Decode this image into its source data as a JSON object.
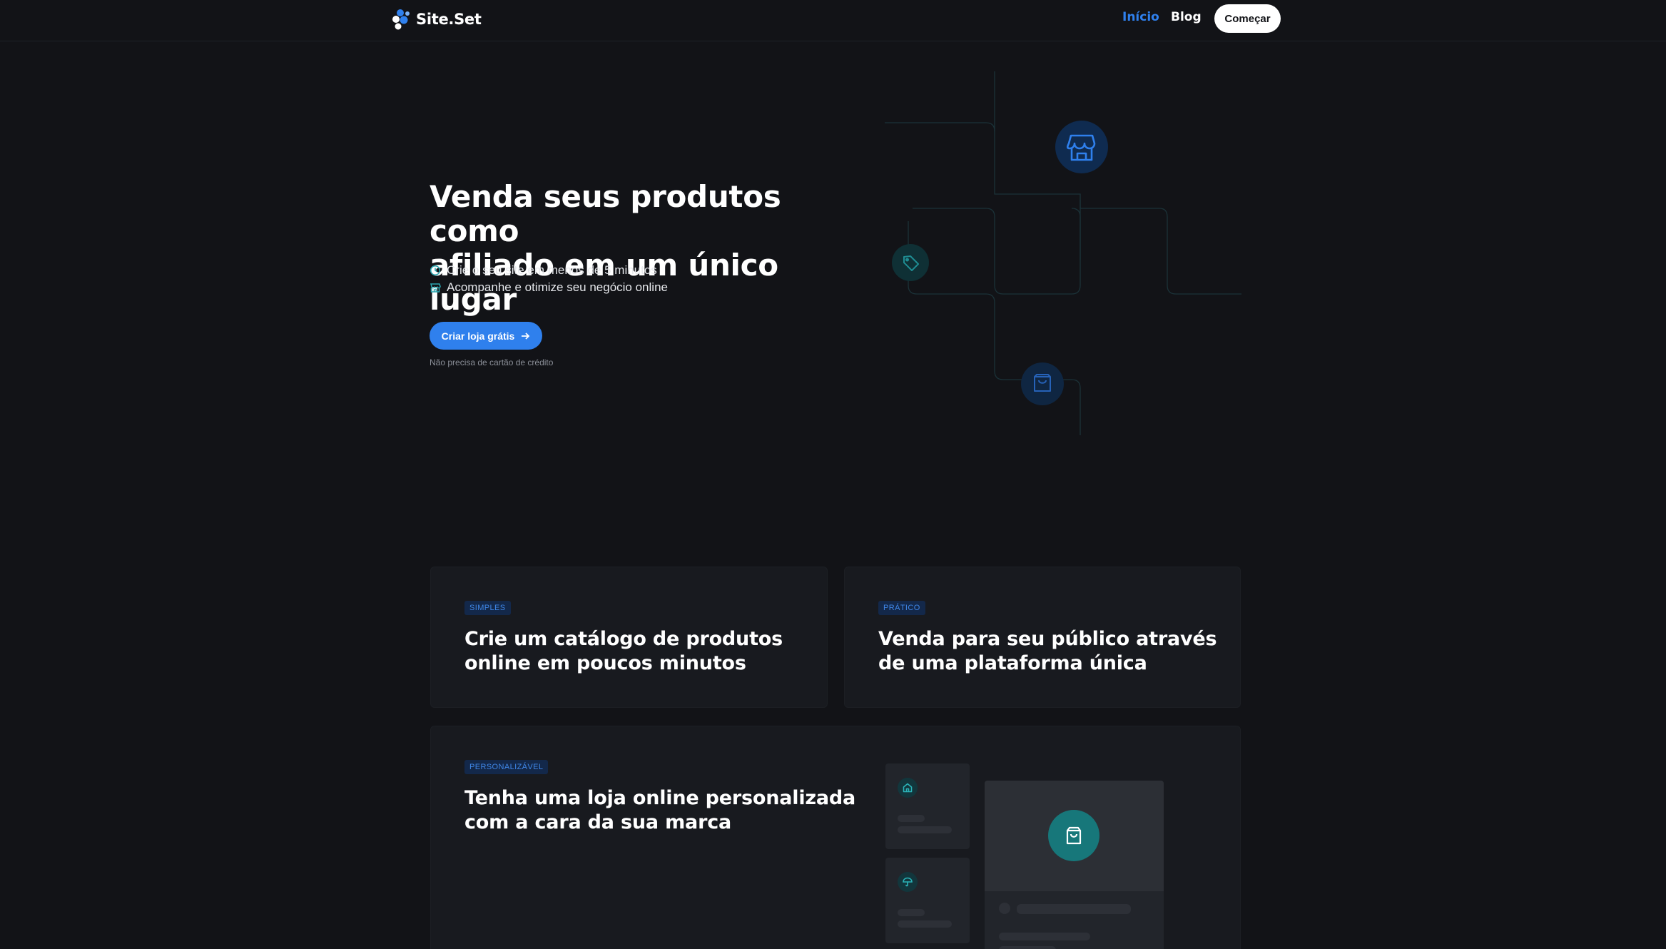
{
  "header": {
    "brand": "Site.Set",
    "nav": [
      {
        "label": "Início",
        "active": true
      },
      {
        "label": "Blog",
        "active": false
      }
    ],
    "cta_label": "Começar"
  },
  "hero": {
    "title_line1": "Venda seus produtos como",
    "title_line2": "afiliado em um único lugar",
    "features": [
      {
        "icon": "clock-icon",
        "text": "Crie o seu site em menos de 5 minutos"
      },
      {
        "icon": "store-icon",
        "text": "Acompanhe e otimize seu negócio online"
      }
    ],
    "cta_label": "Criar loja grátis",
    "cta_note": "Não precisa de cartão de crédito",
    "illustration_icons": [
      "store-icon",
      "tag-icon",
      "shopping-bag-icon"
    ]
  },
  "cards": [
    {
      "tag": "SIMPLES",
      "title_line1": "Crie um catálogo de produtos",
      "title_line2": "online em poucos minutos"
    },
    {
      "tag": "PRÁTICO",
      "title_line1": "Venda para seu público através",
      "title_line2": "de uma plataforma única"
    },
    {
      "tag": "PERSONALIZÁVEL",
      "title_line1": "Tenha uma loja online personalizada",
      "title_line2": "com a cara da sua marca"
    }
  ],
  "mock_store": {
    "icons": [
      "home-icon",
      "umbrella-icon",
      "shopping-bag-icon"
    ]
  },
  "colors": {
    "background": "#121317",
    "accent": "#2f80ed",
    "card": "#181a1f",
    "teal": "#17777a"
  }
}
